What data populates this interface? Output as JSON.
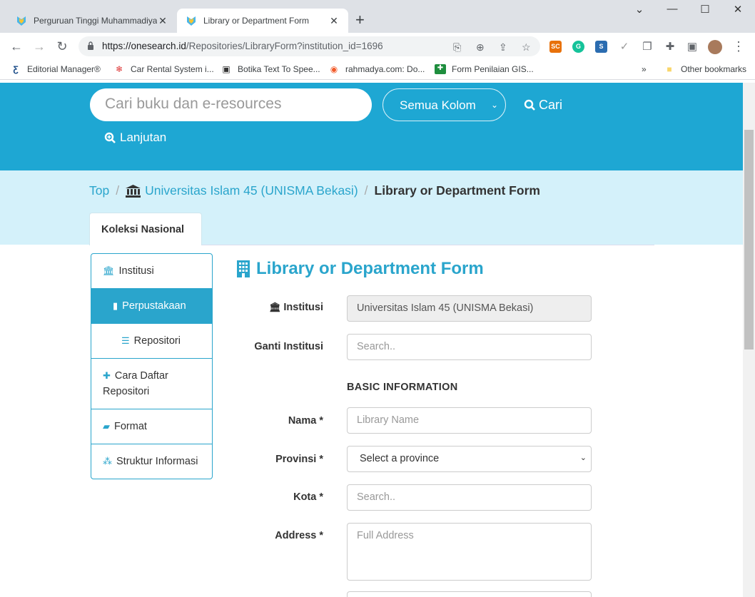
{
  "browser": {
    "tabs": [
      {
        "title": "Perguruan Tinggi Muhammadiyah",
        "active": false
      },
      {
        "title": "Library or Department Form",
        "active": true
      }
    ],
    "url_host": "https://onesearch.id",
    "url_path": "/Repositories/LibraryForm?institution_id=1696",
    "extensions": [
      "SC",
      "G",
      "S"
    ],
    "bookmarks": [
      {
        "label": "Editorial Manager®"
      },
      {
        "label": "Car Rental System i..."
      },
      {
        "label": "Botika Text To Spee..."
      },
      {
        "label": "rahmadya.com: Do..."
      },
      {
        "label": "Form Penilaian GIS..."
      }
    ],
    "bookmarks_overflow": "»",
    "other_bookmarks": "Other bookmarks"
  },
  "header": {
    "search_placeholder": "Cari buku dan e-resources",
    "column_select": "Semua Kolom",
    "search_button": "Cari",
    "advanced_button": "Lanjutan"
  },
  "breadcrumb": {
    "top": "Top",
    "institution": "Universitas Islam 45 (UNISMA Bekasi)",
    "current": "Library or Department Form"
  },
  "tab_label": "Koleksi Nasional",
  "sidebar": {
    "items": [
      {
        "label": "Institusi"
      },
      {
        "label": "Perpustakaan"
      },
      {
        "label": "Repositori"
      },
      {
        "label": "Cara Daftar Repositori"
      },
      {
        "label": "Format"
      },
      {
        "label": "Struktur Informasi"
      }
    ]
  },
  "form": {
    "title": "Library or Department Form",
    "institusi_label": "Institusi",
    "institusi_value": "Universitas Islam 45 (UNISMA Bekasi)",
    "ganti_label": "Ganti Institusi",
    "ganti_placeholder": "Search..",
    "section": "BASIC INFORMATION",
    "nama_label": "Nama *",
    "nama_placeholder": "Library Name",
    "provinsi_label": "Provinsi *",
    "provinsi_value": "Select a province",
    "kota_label": "Kota *",
    "kota_placeholder": "Search..",
    "address_label": "Address *",
    "address_placeholder": "Full Address"
  }
}
